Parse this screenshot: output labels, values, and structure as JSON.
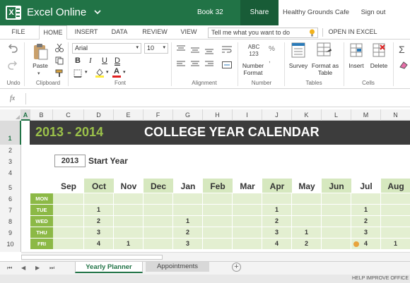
{
  "app": {
    "name": "Excel Online",
    "workbook": "Book 32",
    "share_label": "Share",
    "org": "Healthy Grounds Cafe",
    "signout_label": "Sign out",
    "brand_color": "#217346"
  },
  "tabs": [
    {
      "label": "FILE"
    },
    {
      "label": "HOME",
      "active": true
    },
    {
      "label": "INSERT"
    },
    {
      "label": "DATA"
    },
    {
      "label": "REVIEW"
    },
    {
      "label": "VIEW"
    }
  ],
  "tell_me_placeholder": "Tell me what you want to do",
  "open_in_excel": "OPEN IN EXCEL",
  "ribbon": {
    "undo_label": "Undo",
    "clipboard_label": "Clipboard",
    "paste_label": "Paste",
    "font_name": "Arial",
    "font_size": "10",
    "font_group_label": "Font",
    "alignment_label": "Alignment",
    "number_format_label": "Number Format",
    "number_label": "Number",
    "survey_label": "Survey",
    "format_table_label": "Format as Table",
    "tables_label": "Tables",
    "insert_label": "Insert",
    "delete_label": "Delete",
    "cells_label": "Cells",
    "bold": "B",
    "italic": "I",
    "underline": "U",
    "double_underline": "D",
    "font_color_letter": "A",
    "number_icon_text": "ABC 123"
  },
  "formula_bar": {
    "fx": "fx",
    "value": ""
  },
  "columns": [
    "A",
    "B",
    "C",
    "D",
    "E",
    "F",
    "G",
    "H",
    "I",
    "J",
    "K",
    "L",
    "M",
    "N"
  ],
  "rows": [
    "1",
    "2",
    "3",
    "4",
    "5",
    "6",
    "7",
    "8",
    "9",
    "10"
  ],
  "calendar": {
    "year_range": "2013 - 2014",
    "title": "COLLEGE YEAR CALENDAR",
    "start_year": "2013",
    "start_year_label": "Start Year",
    "months": [
      "Sep",
      "Oct",
      "Nov",
      "Dec",
      "Jan",
      "Feb",
      "Mar",
      "Apr",
      "May",
      "Jun",
      "Jul",
      "Aug"
    ],
    "days": [
      "MON",
      "TUE",
      "WED",
      "THU",
      "FRI"
    ],
    "cells": [
      [
        "",
        "",
        "",
        "",
        "",
        "",
        "",
        "",
        "",
        "",
        "",
        ""
      ],
      [
        "",
        "1",
        "",
        "",
        "",
        "",
        "",
        "1",
        "",
        "",
        "1",
        ""
      ],
      [
        "",
        "2",
        "",
        "",
        "1",
        "",
        "",
        "2",
        "",
        "",
        "2",
        ""
      ],
      [
        "",
        "3",
        "",
        "",
        "2",
        "",
        "",
        "3",
        "1",
        "",
        "3",
        ""
      ],
      [
        "",
        "4",
        "1",
        "",
        "3",
        "",
        "",
        "4",
        "2",
        "",
        "4",
        "1"
      ]
    ],
    "header_bg": "#3c3c3c",
    "year_color": "#9bc14a",
    "green_cell": "#e3efd1",
    "green_month": "#d6e8bf",
    "day_color": "#8cb946"
  },
  "sheets": [
    {
      "label": "Yearly Planner",
      "active": true
    },
    {
      "label": "Appointments",
      "active": false
    }
  ],
  "status_text": "HELP IMPROVE OFFICE"
}
